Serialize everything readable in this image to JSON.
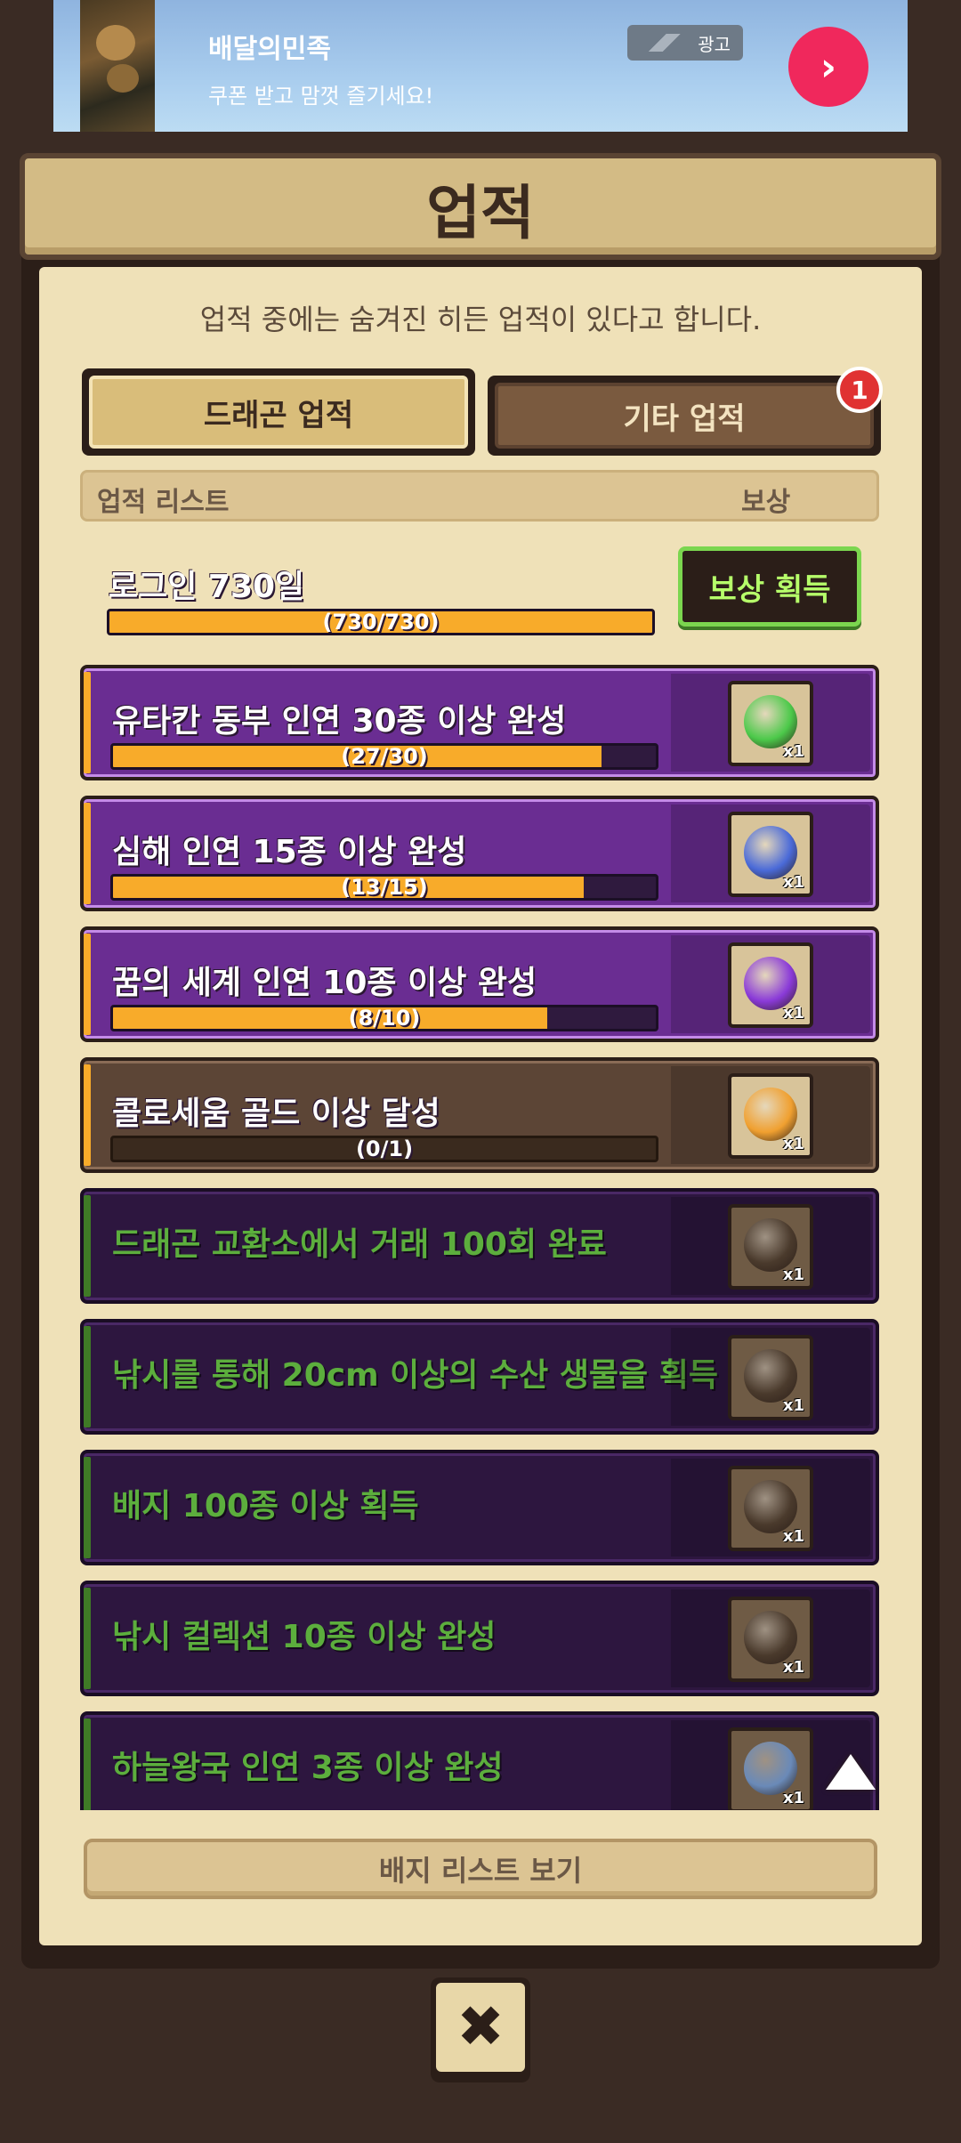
{
  "ad": {
    "title": "배달의민족",
    "subtitle": "쿠폰 받고 맘껏 즐기세요!",
    "badge": "광고",
    "arrow": "›"
  },
  "window": {
    "title": "업적",
    "subtitle": "업적 중에는 숨겨진 히든 업적이 있다고 합니다.",
    "tabs": [
      {
        "label": "드래곤 업적",
        "selected": true
      },
      {
        "label": "기타 업적",
        "selected": false,
        "notification": "1"
      }
    ],
    "list_header": {
      "name": "업적 리스트",
      "reward": "보상"
    },
    "achievements": [
      {
        "title": "로그인 730일",
        "progress_text": "(730/730)",
        "progress": 1.0,
        "state": "complete",
        "claim_label": "보상 획득"
      },
      {
        "title": "유타칸 동부 인연 30종 이상 완성",
        "progress_text": "(27/30)",
        "progress": 0.9,
        "state": "active",
        "reward_icon": "green-heart-medal-icon",
        "reward_count": "x1",
        "reward_color": "#4cc94a"
      },
      {
        "title": "심해 인연 15종 이상 완성",
        "progress_text": "(13/15)",
        "progress": 0.867,
        "state": "active",
        "reward_icon": "blue-heart-medal-icon",
        "reward_count": "x1",
        "reward_color": "#4a6ad8"
      },
      {
        "title": "꿈의 세계 인연 10종 이상 완성",
        "progress_text": "(8/10)",
        "progress": 0.8,
        "state": "active",
        "reward_icon": "purple-heart-medal-icon",
        "reward_count": "x1",
        "reward_color": "#8a3ad8"
      },
      {
        "title": "콜로세움 골드 이상 달성",
        "progress_text": "(0/1)",
        "progress": 0.0,
        "state": "progress",
        "reward_icon": "gold-badge-icon",
        "reward_count": "x1",
        "reward_color": "#f0a030"
      },
      {
        "title": "드래곤 교환소에서 거래 100회 완료",
        "state": "locked",
        "reward_icon": "trade-chest-icon",
        "reward_count": "x1",
        "reward_color": "#4a3a2c"
      },
      {
        "title": "낚시를 통해 20cm 이상의 수산 생물을 획득",
        "state": "locked",
        "reward_icon": "fish-icon",
        "reward_count": "x1",
        "reward_color": "#4a3a2c"
      },
      {
        "title": "배지 100종 이상 획득",
        "state": "locked",
        "reward_icon": "badge-board-icon",
        "reward_count": "x1",
        "reward_color": "#4a3a2c"
      },
      {
        "title": "낚시 컬렉션 10종 이상 완성",
        "state": "locked",
        "reward_icon": "fish-collection-icon",
        "reward_count": "x1",
        "reward_color": "#4a3a2c"
      },
      {
        "title": "하늘왕국 인연 3종 이상 완성",
        "state": "locked",
        "reward_icon": "sky-medal-icon",
        "reward_count": "x1",
        "reward_color": "#6a8ab8"
      }
    ],
    "badge_list_button": "배지 리스트 보기",
    "close_icon": "✖"
  },
  "colors": {
    "complete": "#7bd64f",
    "active": "#6a2d92",
    "progress_fill": "#f8ab2a",
    "locked": "#2d163f"
  }
}
